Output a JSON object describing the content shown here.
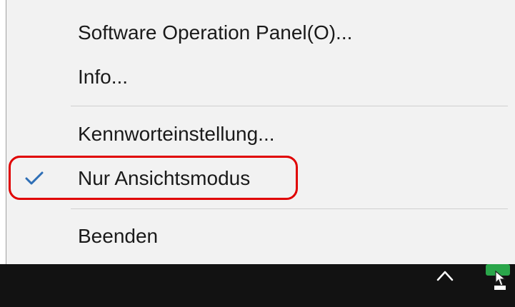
{
  "menu": {
    "items": [
      {
        "label": "Software Operation Panel(O)..."
      },
      {
        "label": "Info..."
      },
      {
        "label": "Kennworteinstellung..."
      },
      {
        "label": "Nur Ansichtsmodus",
        "checked": true,
        "highlighted": true
      },
      {
        "label": "Beenden"
      }
    ]
  },
  "icons": {
    "check": "check-icon",
    "tray_chevron": "chevron-up-icon",
    "tray_app": "scanner-tray-icon"
  },
  "colors": {
    "menu_background": "#f2f2f2",
    "checkmark": "#2f6fb6",
    "highlight_outline": "#e00000",
    "taskbar": "#121212",
    "tray_app_green": "#2aa64a"
  }
}
